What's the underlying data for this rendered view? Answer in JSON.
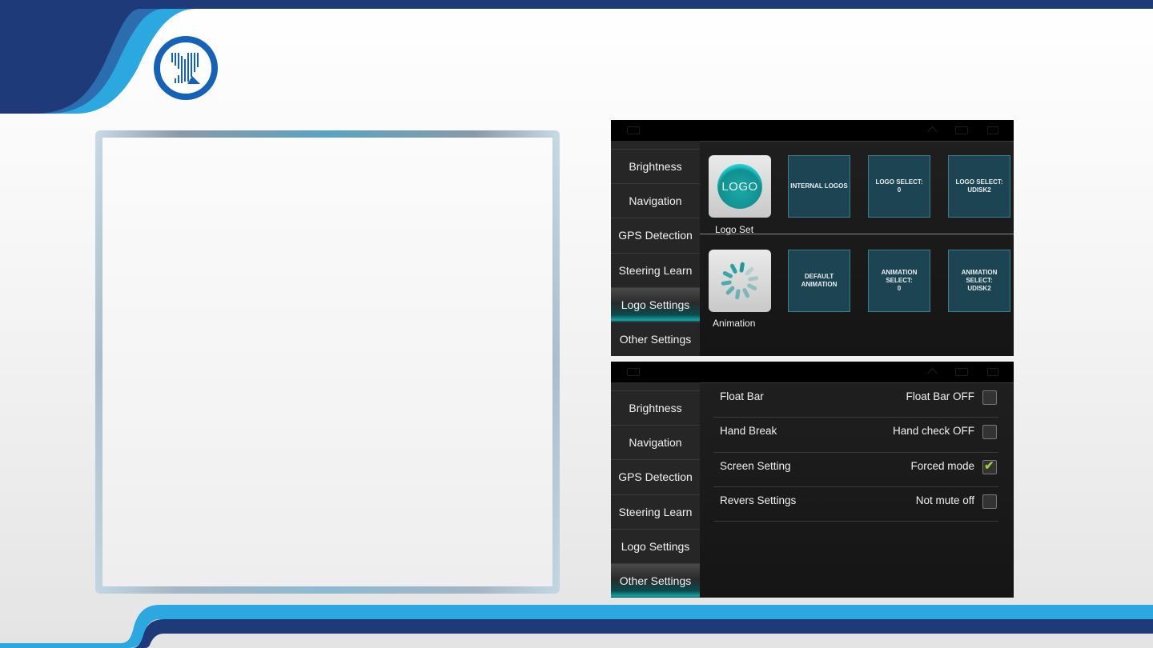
{
  "header": {
    "brand_logo_icon": "x-brand-logo",
    "colors": {
      "navy": "#1f3a78",
      "blue": "#2aa8df",
      "mid_blue": "#2c6db0"
    }
  },
  "content_frame": {
    "text": ""
  },
  "screens": [
    {
      "name": "logo-settings",
      "side_menu": [
        {
          "label": "Brightness",
          "active": false
        },
        {
          "label": "Navigation",
          "active": false
        },
        {
          "label": "GPS Detection",
          "active": false
        },
        {
          "label": "Steering Learn",
          "active": false
        },
        {
          "label": "Logo Settings",
          "active": true
        },
        {
          "label": "Other Settings",
          "active": false
        }
      ],
      "rows": [
        {
          "icon_label": "LOGO",
          "caption": "Logo Set",
          "tiles": [
            "INTERNAL LOGOS",
            "LOGO SELECT:\n0",
            "LOGO SELECT:\nUDISK2"
          ]
        },
        {
          "icon_label": "",
          "caption": "Animation",
          "tiles": [
            "DEFAULT\nANIMATION",
            "ANIMATION\nSELECT:\n0",
            "ANIMATION\nSELECT:\nUDISK2"
          ]
        }
      ]
    },
    {
      "name": "other-settings",
      "side_menu": [
        {
          "label": "Brightness",
          "active": false
        },
        {
          "label": "Navigation",
          "active": false
        },
        {
          "label": "GPS Detection",
          "active": false
        },
        {
          "label": "Steering Learn",
          "active": false
        },
        {
          "label": "Logo Settings",
          "active": false
        },
        {
          "label": "Other Settings",
          "active": true
        }
      ],
      "settings": [
        {
          "label": "Float Bar",
          "value": "Float Bar OFF",
          "checked": false
        },
        {
          "label": "Hand Break",
          "value": "Hand check OFF",
          "checked": false
        },
        {
          "label": "Screen Setting",
          "value": "Forced mode",
          "checked": true
        },
        {
          "label": "Revers Settings",
          "value": "Not mute off",
          "checked": false
        }
      ]
    }
  ]
}
